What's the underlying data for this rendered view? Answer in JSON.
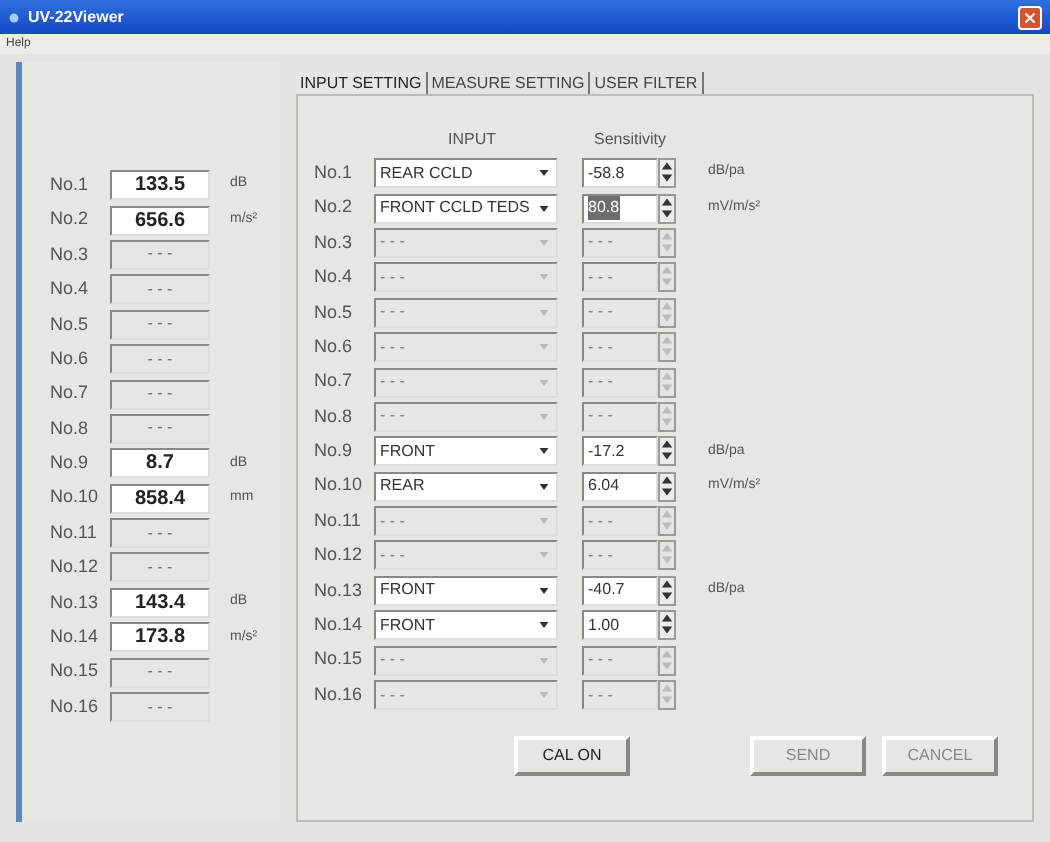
{
  "window": {
    "title": "UV-22Viewer"
  },
  "menu": [
    {
      "label": "Help"
    }
  ],
  "readings": [
    {
      "label": "No.1",
      "value": "133.5",
      "unit": "dB",
      "disabled": false
    },
    {
      "label": "No.2",
      "value": "656.6",
      "unit": "m/s²",
      "disabled": false
    },
    {
      "label": "No.3",
      "value": "- - -",
      "disabled": true
    },
    {
      "label": "No.4",
      "value": "- - -",
      "disabled": true
    },
    {
      "label": "No.5",
      "value": "- - -",
      "disabled": true
    },
    {
      "label": "No.6",
      "value": "- - -",
      "disabled": true
    },
    {
      "label": "No.7",
      "value": "- - -",
      "disabled": true
    },
    {
      "label": "No.8",
      "value": "- - -",
      "disabled": true
    },
    {
      "label": "No.9",
      "value": "8.7",
      "unit": "dB",
      "disabled": false
    },
    {
      "label": "No.10",
      "value": "858.4",
      "unit": "mm",
      "disabled": false
    },
    {
      "label": "No.11",
      "value": "- - -",
      "disabled": true
    },
    {
      "label": "No.12",
      "value": "- - -",
      "disabled": true
    },
    {
      "label": "No.13",
      "value": "143.4",
      "unit": "dB",
      "disabled": false
    },
    {
      "label": "No.14",
      "value": "173.8",
      "unit": "m/s²",
      "disabled": false
    },
    {
      "label": "No.15",
      "value": "- - -",
      "disabled": true
    },
    {
      "label": "No.16",
      "value": "- - -",
      "disabled": true
    }
  ],
  "tabs": [
    {
      "label": "INPUT SETTING",
      "selected": true
    },
    {
      "label": "MEASURE SETTING",
      "selected": false
    },
    {
      "label": "USER FILTER",
      "selected": false
    }
  ],
  "columns": {
    "input": "INPUT",
    "sensitivity": "Sensitivity"
  },
  "channels": [
    {
      "label": "No.1",
      "input": "REAR CCLD",
      "sensitivity": "-58.8",
      "unit": "dB/pa",
      "disabled": false,
      "highlighted": false
    },
    {
      "label": "No.2",
      "input": "FRONT CCLD TEDS",
      "sensitivity": "80.8",
      "unit": "mV/m/s²",
      "disabled": false,
      "highlighted": true
    },
    {
      "label": "No.3",
      "input": "- - -",
      "sensitivity": "- - -",
      "disabled": true,
      "highlighted": false
    },
    {
      "label": "No.4",
      "input": "- - -",
      "sensitivity": "- - -",
      "disabled": true,
      "highlighted": false
    },
    {
      "label": "No.5",
      "input": "- - -",
      "sensitivity": "- - -",
      "disabled": true,
      "highlighted": false
    },
    {
      "label": "No.6",
      "input": "- - -",
      "sensitivity": "- - -",
      "disabled": true,
      "highlighted": false
    },
    {
      "label": "No.7",
      "input": "- - -",
      "sensitivity": "- - -",
      "disabled": true,
      "highlighted": false
    },
    {
      "label": "No.8",
      "input": "- - -",
      "sensitivity": "- - -",
      "disabled": true,
      "highlighted": false
    },
    {
      "label": "No.9",
      "input": "FRONT",
      "sensitivity": "-17.2",
      "unit": "dB/pa",
      "disabled": false,
      "highlighted": false
    },
    {
      "label": "No.10",
      "input": "REAR",
      "sensitivity": "6.04",
      "unit": "mV/m/s²",
      "disabled": false,
      "highlighted": false
    },
    {
      "label": "No.11",
      "input": "- - -",
      "sensitivity": "- - -",
      "disabled": true,
      "highlighted": false
    },
    {
      "label": "No.12",
      "input": "- - -",
      "sensitivity": "- - -",
      "disabled": true,
      "highlighted": false
    },
    {
      "label": "No.13",
      "input": "FRONT",
      "sensitivity": "-40.7",
      "unit": "dB/pa",
      "disabled": false,
      "highlighted": false
    },
    {
      "label": "No.14",
      "input": "FRONT",
      "sensitivity": "1.00",
      "disabled": false,
      "highlighted": false
    },
    {
      "label": "No.15",
      "input": "- - -",
      "sensitivity": "- - -",
      "disabled": true,
      "highlighted": false
    },
    {
      "label": "No.16",
      "input": "- - -",
      "sensitivity": "- - -",
      "disabled": true,
      "highlighted": false
    }
  ],
  "buttons": [
    {
      "label": "CAL ON",
      "disabled": false
    },
    {
      "label": "SEND",
      "disabled": true
    },
    {
      "label": "CANCEL",
      "disabled": true
    }
  ]
}
